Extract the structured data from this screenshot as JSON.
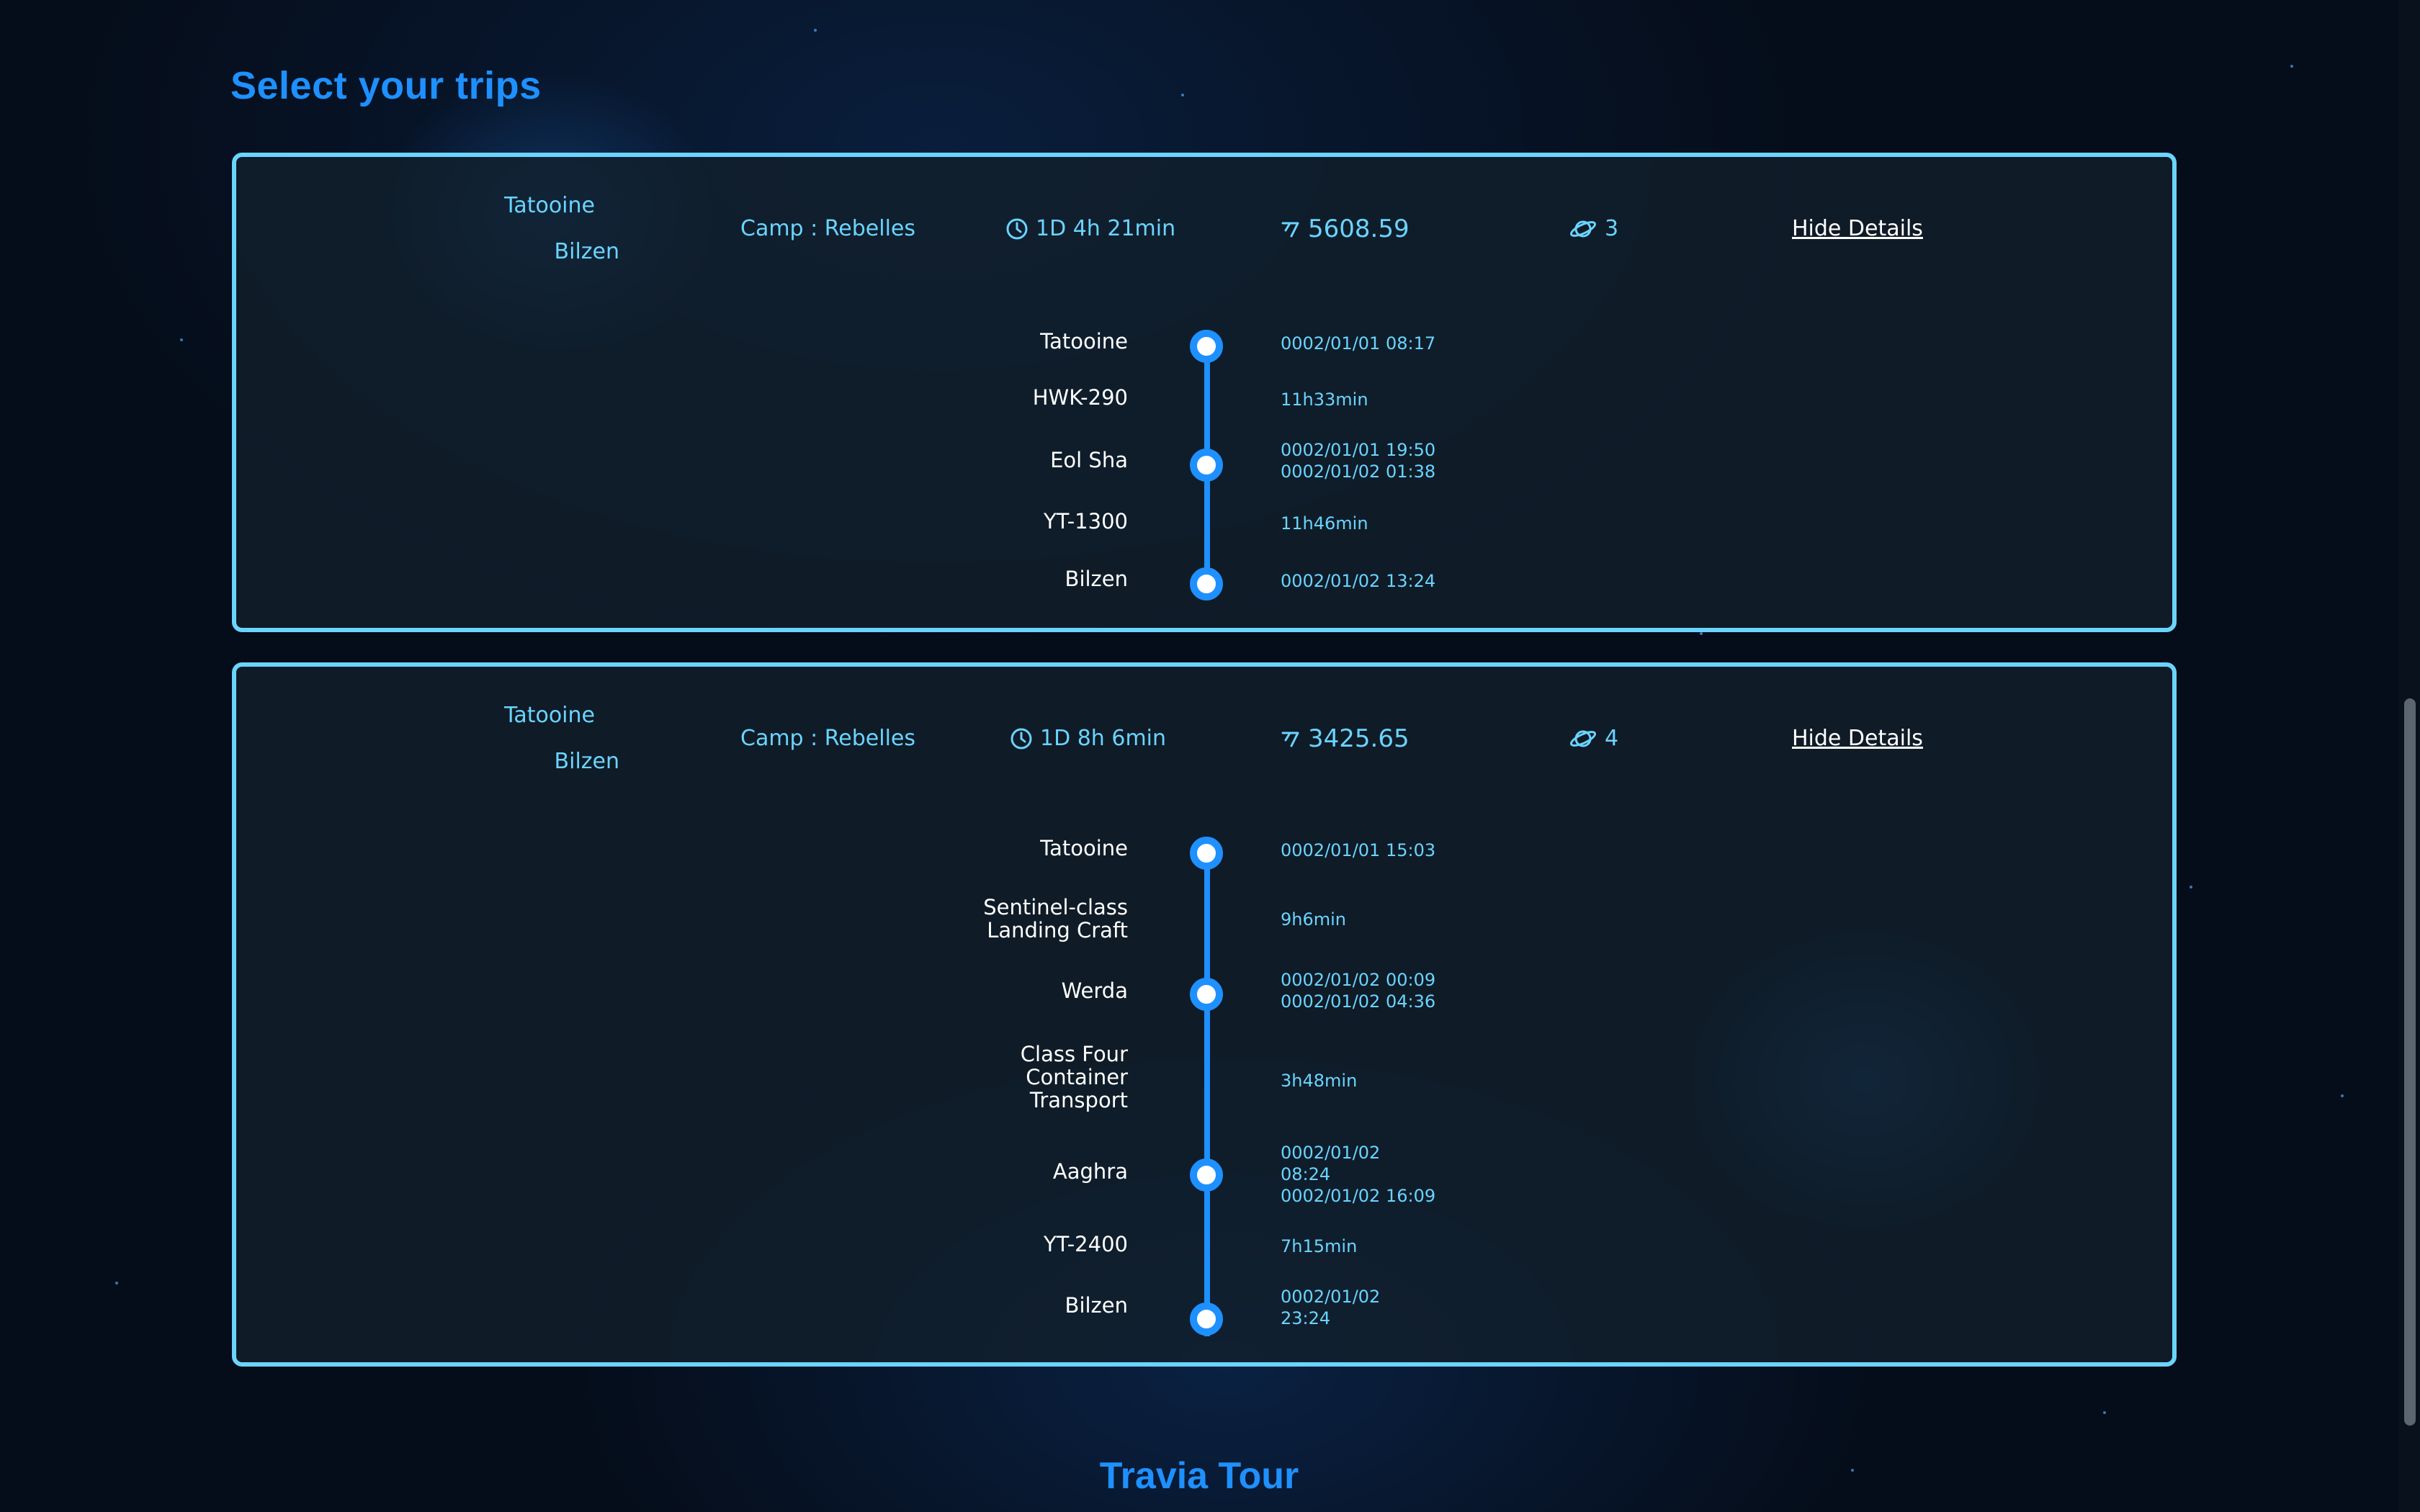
{
  "page": {
    "title": "Select your trips",
    "footer": "Travia Tour"
  },
  "colors": {
    "accent": "#1e90ff",
    "highlight": "#6ad4ff",
    "text": "#ffffff",
    "background": "#050d1a"
  },
  "trips": [
    {
      "origin": "Tatooine",
      "destination": "Bilzen",
      "camp": "Camp : Rebelles",
      "duration": "1D 4h 21min",
      "price": "5608.59",
      "stops": "3",
      "toggle_label": "Hide Details",
      "icons": {
        "duration": "clock-icon",
        "price": "credits-icon",
        "stops": "planet-icon"
      },
      "route": [
        {
          "type": "stop",
          "name": "Tatooine",
          "info": [
            "0002/01/01 08:17"
          ]
        },
        {
          "type": "leg",
          "name": "HWK-290",
          "info": [
            "11h33min"
          ]
        },
        {
          "type": "stop",
          "name": "Eol Sha",
          "info": [
            "0002/01/01 19:50",
            "0002/01/02 01:38"
          ]
        },
        {
          "type": "leg",
          "name": "YT-1300",
          "info": [
            "11h46min"
          ]
        },
        {
          "type": "stop",
          "name": "Bilzen",
          "info": [
            "0002/01/02 13:24"
          ]
        }
      ]
    },
    {
      "origin": "Tatooine",
      "destination": "Bilzen",
      "camp": "Camp : Rebelles",
      "duration": "1D 8h 6min",
      "price": "3425.65",
      "stops": "4",
      "toggle_label": "Hide Details",
      "icons": {
        "duration": "clock-icon",
        "price": "credits-icon",
        "stops": "planet-icon"
      },
      "route": [
        {
          "type": "stop",
          "name": "Tatooine",
          "info": [
            "0002/01/01 15:03"
          ]
        },
        {
          "type": "leg",
          "name": "Sentinel-class\nLanding Craft",
          "info": [
            "9h6min"
          ]
        },
        {
          "type": "stop",
          "name": "Werda",
          "info": [
            "0002/01/02 00:09",
            "0002/01/02 04:36"
          ]
        },
        {
          "type": "leg",
          "name": "Class Four\nContainer\nTransport",
          "info": [
            "3h48min"
          ]
        },
        {
          "type": "stop",
          "name": "Aaghra",
          "info": [
            "0002/01/02",
            "08:24",
            "0002/01/02 16:09"
          ]
        },
        {
          "type": "leg",
          "name": "YT-2400",
          "info": [
            "7h15min"
          ]
        },
        {
          "type": "stop",
          "name": "Bilzen",
          "info": [
            "0002/01/02",
            "23:24"
          ]
        }
      ]
    }
  ]
}
